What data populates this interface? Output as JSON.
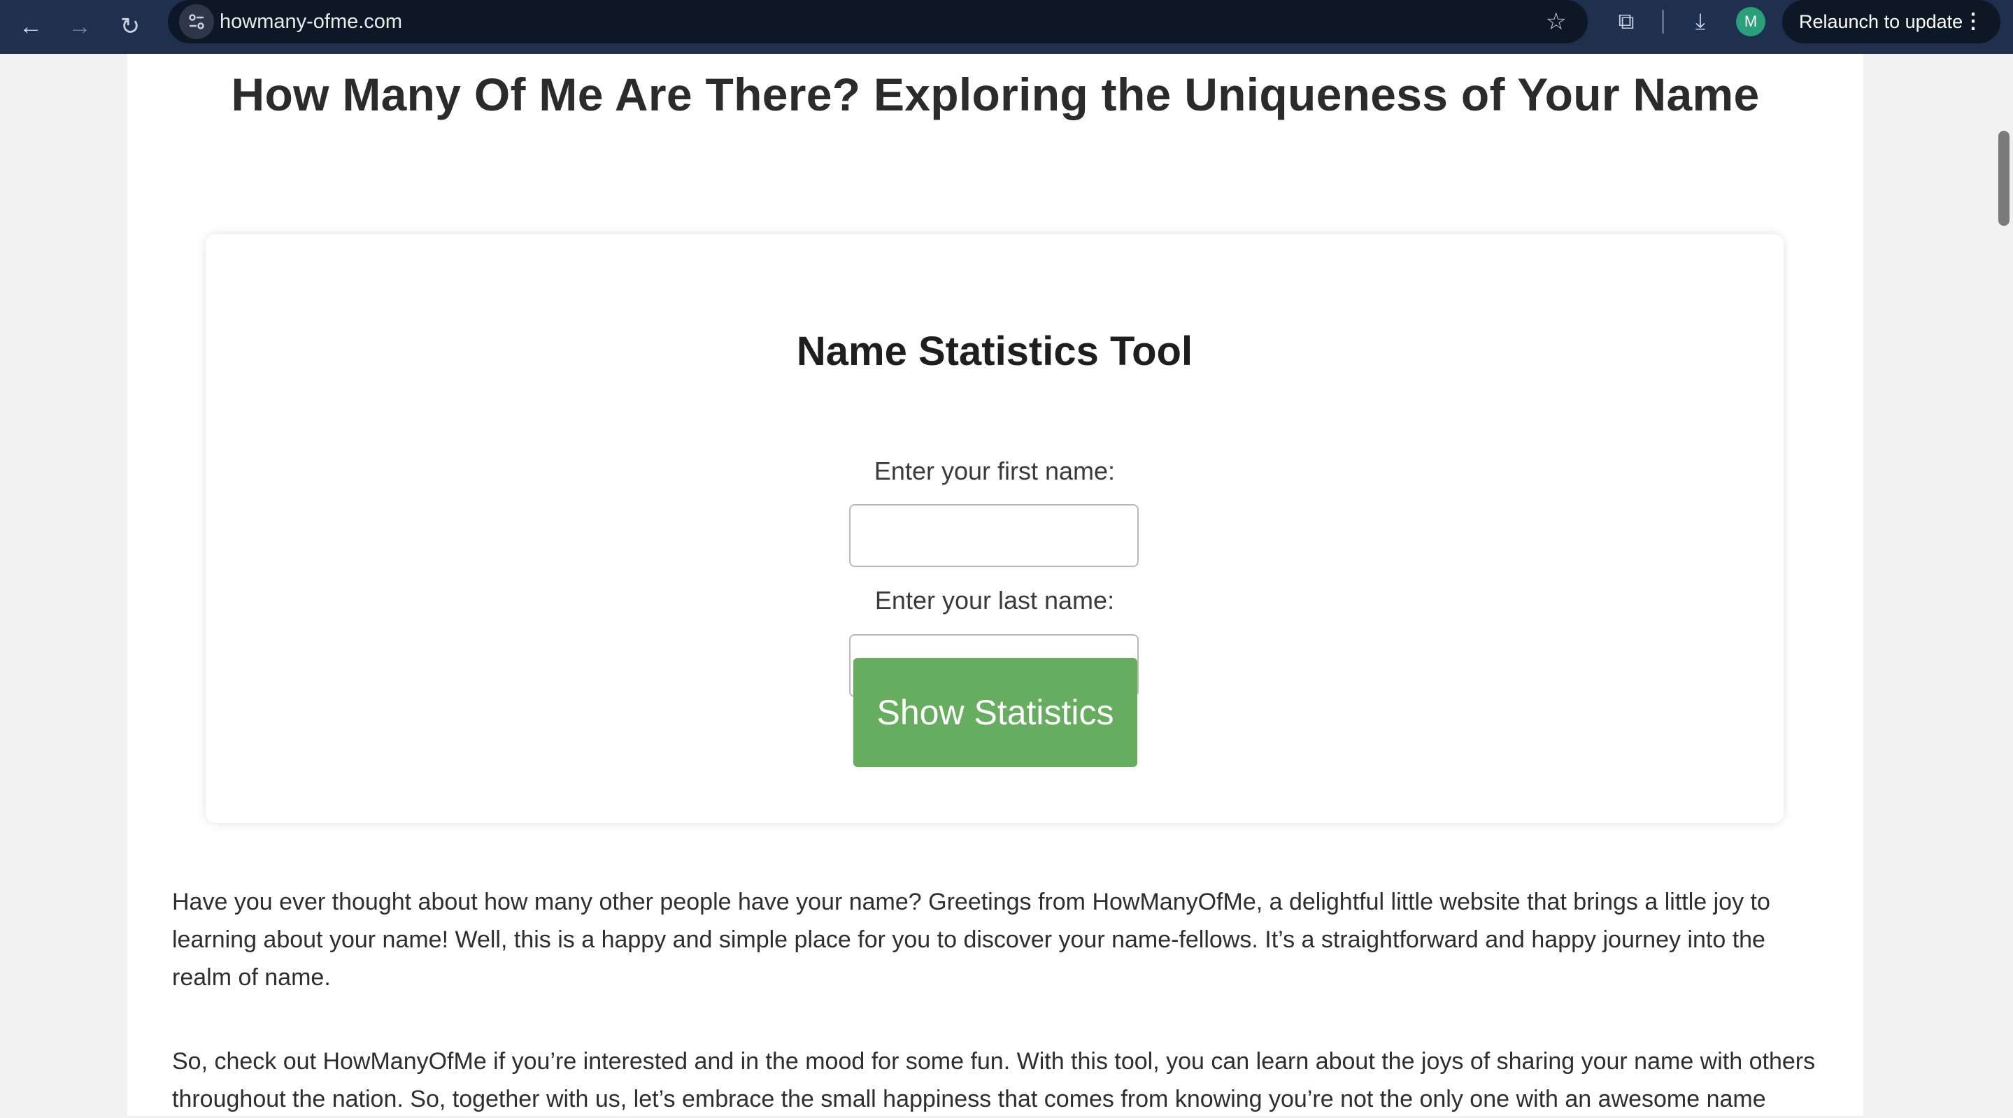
{
  "browser": {
    "url": "howmany-ofme.com",
    "profile_initial": "M",
    "relaunch_label": "Relaunch to update",
    "menu_glyph": "⋮",
    "icons": {
      "back": "←",
      "forward": "→",
      "reload": "↻",
      "star": "☆",
      "extensions": "⧉",
      "download": "⤓"
    }
  },
  "page": {
    "title": "How Many Of Me Are There? Exploring the Uniqueness of Your Name",
    "tool": {
      "title": "Name Statistics Tool",
      "first_name_label": "Enter your first name:",
      "first_name_value": "",
      "last_name_label": "Enter your last name:",
      "last_name_value": "",
      "button_label": "Show Statistics"
    },
    "paragraphs": [
      "Have you ever thought about how many other people have your name? Greetings from HowManyOfMe, a delightful little website that brings a little joy to learning about your name! Well, this is a happy and simple place for you to discover your name-fellows. It’s a straightforward and happy journey into the realm of name.",
      "So, check out HowManyOfMe if you’re interested and in the mood for some fun. With this tool, you can learn about the joys of sharing your name with others throughout the nation.  So, together with us, let’s embrace the small happiness that comes from knowing you’re not the only one with an awesome name"
    ]
  },
  "colors": {
    "chrome": "#1f2f4e",
    "button": "#66ad5f",
    "avatar": "#2aa07a"
  }
}
